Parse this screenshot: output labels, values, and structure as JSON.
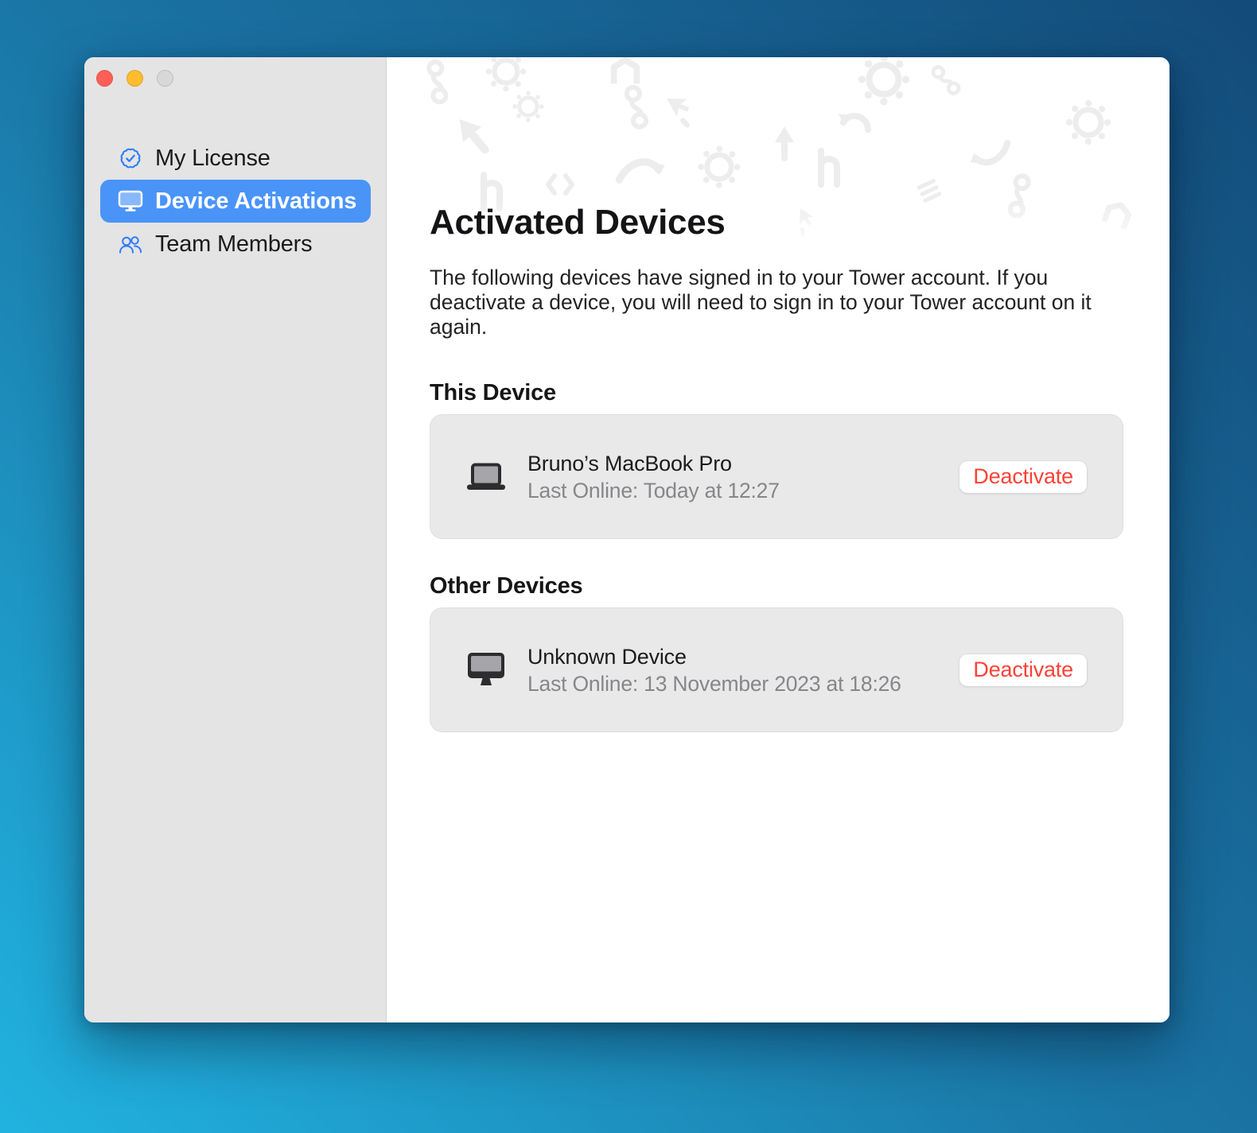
{
  "window": {
    "controls": [
      "close",
      "minimize",
      "zoom"
    ]
  },
  "sidebar": {
    "items": [
      {
        "label": "My License",
        "icon": "license-seal-check-icon",
        "selected": false
      },
      {
        "label": "Device Activations",
        "icon": "display-icon",
        "selected": true
      },
      {
        "label": "Team Members",
        "icon": "people-icon",
        "selected": false
      }
    ]
  },
  "main": {
    "title": "Activated Devices",
    "description_lines": [
      "The following devices have signed in to your Tower account. If you",
      "deactivate a device, you will need to sign in to your Tower account on it",
      "again."
    ],
    "sections": [
      {
        "heading": "This Device",
        "device": {
          "icon": "laptop-icon",
          "name": "Bruno’s MacBook Pro",
          "last_online": "Last Online: Today at 12:27",
          "action_label": "Deactivate"
        }
      },
      {
        "heading": "Other Devices",
        "device": {
          "icon": "desktop-display-icon",
          "name": "Unknown Device",
          "last_online": "Last Online: 13 November 2023 at 18:26",
          "action_label": "Deactivate"
        }
      }
    ]
  },
  "colors": {
    "background_gradient_top": "#134b7a",
    "background_gradient_bottom": "#21b3e0",
    "accent_blue": "#4a94f8",
    "sidebar_icon_blue": "#2d7cf7",
    "deactivate_red": "#fb4237",
    "traffic_red": "#ff5f57",
    "traffic_yellow": "#febc2e",
    "traffic_inactive": "#d8d8d8",
    "sidebar_background": "#e4e4e5",
    "card_background": "#e9e9e9"
  }
}
